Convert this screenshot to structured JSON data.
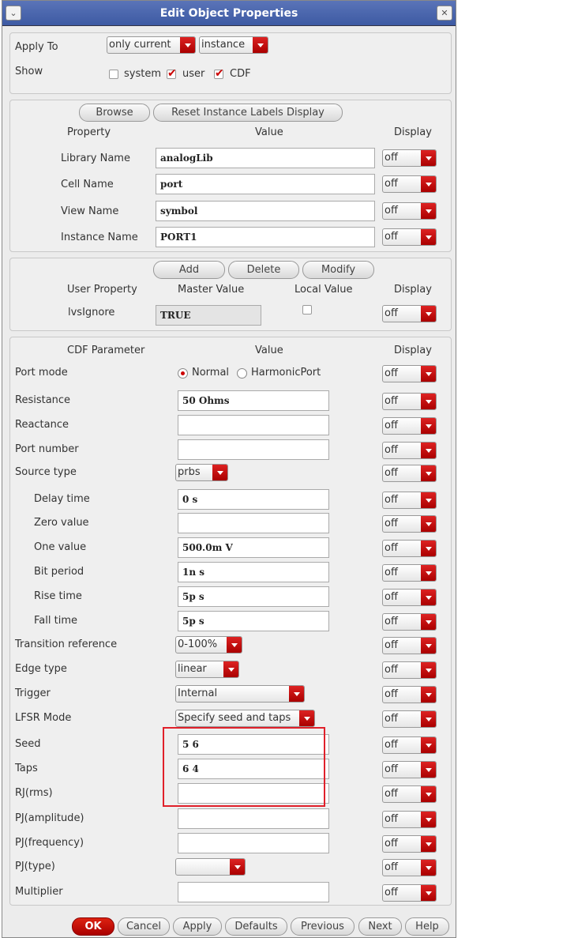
{
  "window": {
    "title": "Edit Object Properties",
    "menu_icon": "chevron-down-icon",
    "close_icon": "close-icon"
  },
  "apply": {
    "label": "Apply To",
    "scope": "only current",
    "type": "instance"
  },
  "show": {
    "label": "Show",
    "system": {
      "label": "system",
      "checked": false
    },
    "user": {
      "label": "user",
      "checked": true
    },
    "cdf": {
      "label": "CDF",
      "checked": true
    }
  },
  "props": {
    "browse": "Browse",
    "reset": "Reset Instance Labels Display",
    "h_property": "Property",
    "h_value": "Value",
    "h_display": "Display",
    "rows": [
      {
        "label": "Library Name",
        "value": "analogLib",
        "display": "off"
      },
      {
        "label": "Cell Name",
        "value": "port",
        "display": "off"
      },
      {
        "label": "View Name",
        "value": "symbol",
        "display": "off"
      },
      {
        "label": "Instance Name",
        "value": "PORT1",
        "display": "off"
      }
    ]
  },
  "user": {
    "add": "Add",
    "delete": "Delete",
    "modify": "Modify",
    "h_user": "User Property",
    "h_master": "Master Value",
    "h_local": "Local Value",
    "h_display": "Display",
    "row": {
      "label": "lvsIgnore",
      "master": "TRUE",
      "local": false,
      "display": "off"
    }
  },
  "cdf": {
    "h_param": "CDF Parameter",
    "h_value": "Value",
    "h_display": "Display",
    "rows": [
      {
        "label": "Port mode",
        "kind": "radio",
        "options": [
          "Normal",
          "HarmonicPort"
        ],
        "selected": 0,
        "display": "off"
      },
      {
        "label": "Resistance",
        "kind": "text",
        "value": "50 Ohms",
        "display": "off"
      },
      {
        "label": "Reactance",
        "kind": "text",
        "value": "",
        "display": "off"
      },
      {
        "label": "Port number",
        "kind": "text",
        "value": "",
        "display": "off"
      },
      {
        "label": "Source type",
        "kind": "select",
        "value": "prbs",
        "display": "off"
      },
      {
        "label": "Delay time",
        "kind": "text",
        "value": "0 s",
        "indent": true,
        "display": "off"
      },
      {
        "label": "Zero value",
        "kind": "text",
        "value": "",
        "indent": true,
        "display": "off"
      },
      {
        "label": "One value",
        "kind": "text",
        "value": "500.0m V",
        "indent": true,
        "display": "off"
      },
      {
        "label": "Bit period",
        "kind": "text",
        "value": "1n s",
        "indent": true,
        "display": "off"
      },
      {
        "label": "Rise time",
        "kind": "text",
        "value": "5p s",
        "indent": true,
        "display": "off"
      },
      {
        "label": "Fall time",
        "kind": "text",
        "value": "5p s",
        "indent": true,
        "display": "off"
      },
      {
        "label": "Transition reference",
        "kind": "select",
        "value": "0-100%",
        "display": "off"
      },
      {
        "label": "Edge type",
        "kind": "select",
        "value": "linear",
        "display": "off"
      },
      {
        "label": "Trigger",
        "kind": "select",
        "value": "Internal",
        "display": "off"
      },
      {
        "label": "LFSR Mode",
        "kind": "select",
        "value": "Specify seed and taps",
        "display": "off"
      },
      {
        "label": "Seed",
        "kind": "text",
        "value": "5 6",
        "display": "off"
      },
      {
        "label": "Taps",
        "kind": "text",
        "value": "6 4",
        "display": "off"
      },
      {
        "label": "RJ(rms)",
        "kind": "text",
        "value": "",
        "display": "off"
      },
      {
        "label": "PJ(amplitude)",
        "kind": "text",
        "value": "",
        "display": "off"
      },
      {
        "label": "PJ(frequency)",
        "kind": "text",
        "value": "",
        "display": "off"
      },
      {
        "label": "PJ(type)",
        "kind": "select",
        "value": "",
        "display": "off"
      },
      {
        "label": "Multiplier",
        "kind": "text",
        "value": "",
        "display": "off"
      }
    ]
  },
  "buttons": {
    "ok": "OK",
    "cancel": "Cancel",
    "apply": "Apply",
    "defaults": "Defaults",
    "previous": "Previous",
    "next": "Next",
    "help": "Help"
  },
  "highlight_color": "#e0202a"
}
